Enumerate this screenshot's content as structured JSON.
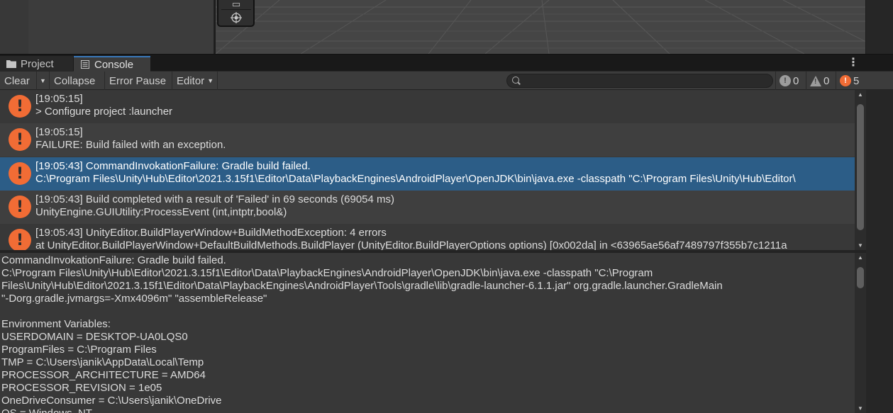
{
  "tabs": {
    "project_label": "Project",
    "console_label": "Console"
  },
  "toolbar": {
    "clear_label": "Clear",
    "collapse_label": "Collapse",
    "error_pause_label": "Error Pause",
    "editor_label": "Editor",
    "search_placeholder": "",
    "info_count": "0",
    "warning_count": "0",
    "error_count": "5"
  },
  "icons": {
    "error_color": "#f16c35",
    "selected_row_color": "#2c5d87",
    "tab_accent": "#3a79bb"
  },
  "log_entries": [
    {
      "line1": "[19:05:15]",
      "line2": "> Configure project :launcher",
      "selected": false
    },
    {
      "line1": "[19:05:15]",
      "line2": "FAILURE: Build failed with an exception.",
      "selected": false
    },
    {
      "line1": "[19:05:43] CommandInvokationFailure: Gradle build failed.",
      "line2": "C:\\Program Files\\Unity\\Hub\\Editor\\2021.3.15f1\\Editor\\Data\\PlaybackEngines\\AndroidPlayer\\OpenJDK\\bin\\java.exe -classpath \"C:\\Program Files\\Unity\\Hub\\Editor\\",
      "selected": true
    },
    {
      "line1": "[19:05:43] Build completed with a result of 'Failed' in 69 seconds (69054 ms)",
      "line2": "UnityEngine.GUIUtility:ProcessEvent (int,intptr,bool&)",
      "selected": false
    },
    {
      "line1": "[19:05:43] UnityEditor.BuildPlayerWindow+BuildMethodException: 4 errors",
      "line2": "  at UnityEditor.BuildPlayerWindow+DefaultBuildMethods.BuildPlayer (UnityEditor.BuildPlayerOptions options) [0x002da] in <63965ae56af7489797f355b7c1211a",
      "selected": false
    }
  ],
  "detail": {
    "lines": [
      "CommandInvokationFailure: Gradle build failed.",
      "C:\\Program Files\\Unity\\Hub\\Editor\\2021.3.15f1\\Editor\\Data\\PlaybackEngines\\AndroidPlayer\\OpenJDK\\bin\\java.exe -classpath \"C:\\Program",
      "Files\\Unity\\Hub\\Editor\\2021.3.15f1\\Editor\\Data\\PlaybackEngines\\AndroidPlayer\\Tools\\gradle\\lib\\gradle-launcher-6.1.1.jar\" org.gradle.launcher.GradleMain",
      "\"-Dorg.gradle.jvmargs=-Xmx4096m\" \"assembleRelease\"",
      "",
      "Environment Variables:",
      "USERDOMAIN = DESKTOP-UA0LQS0",
      "ProgramFiles = C:\\Program Files",
      "TMP = C:\\Users\\janik\\AppData\\Local\\Temp",
      "PROCESSOR_ARCHITECTURE = AMD64",
      "PROCESSOR_REVISION = 1e05",
      "OneDriveConsumer = C:\\Users\\janik\\OneDrive",
      "OS = Windows_NT"
    ]
  }
}
